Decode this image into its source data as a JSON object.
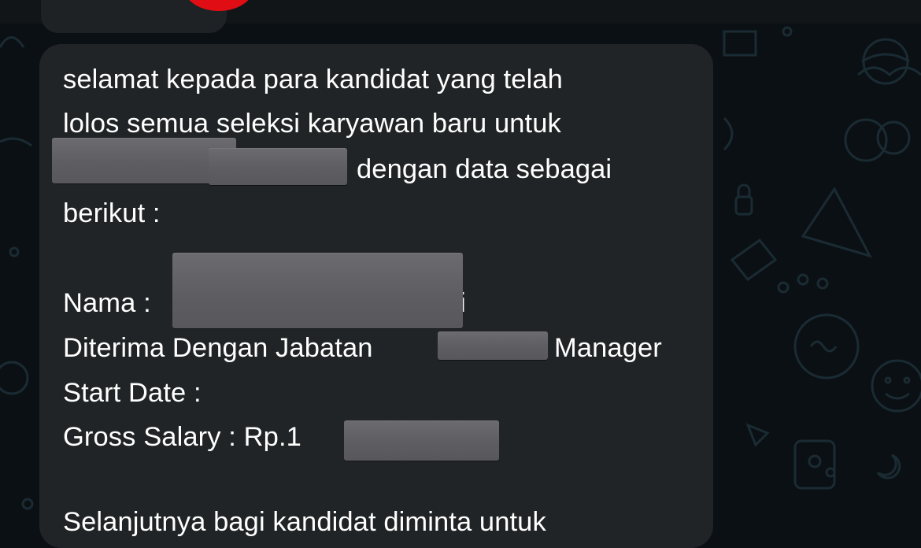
{
  "message": {
    "line_1": "selamat kepada para kandidat yang telah",
    "line_2": "lolos semua seleksi karyawan baru untuk",
    "line_3": "dengan data sebagai",
    "line_4": "berikut :",
    "name_label": "Nama :",
    "name_tail": "i",
    "position_label": "Diterima Dengan Jabatan",
    "position_value": "Manager",
    "start_date_label": "Start Date :",
    "salary_label": "Gross Salary : Rp.1",
    "next_line": "Selanjutnya bagi kandidat diminta untuk"
  },
  "colors": {
    "background": "#0b1014",
    "bubble": "#212426",
    "text": "#ffffff",
    "redaction": "#636367",
    "notification_dot": "#e10d14"
  }
}
